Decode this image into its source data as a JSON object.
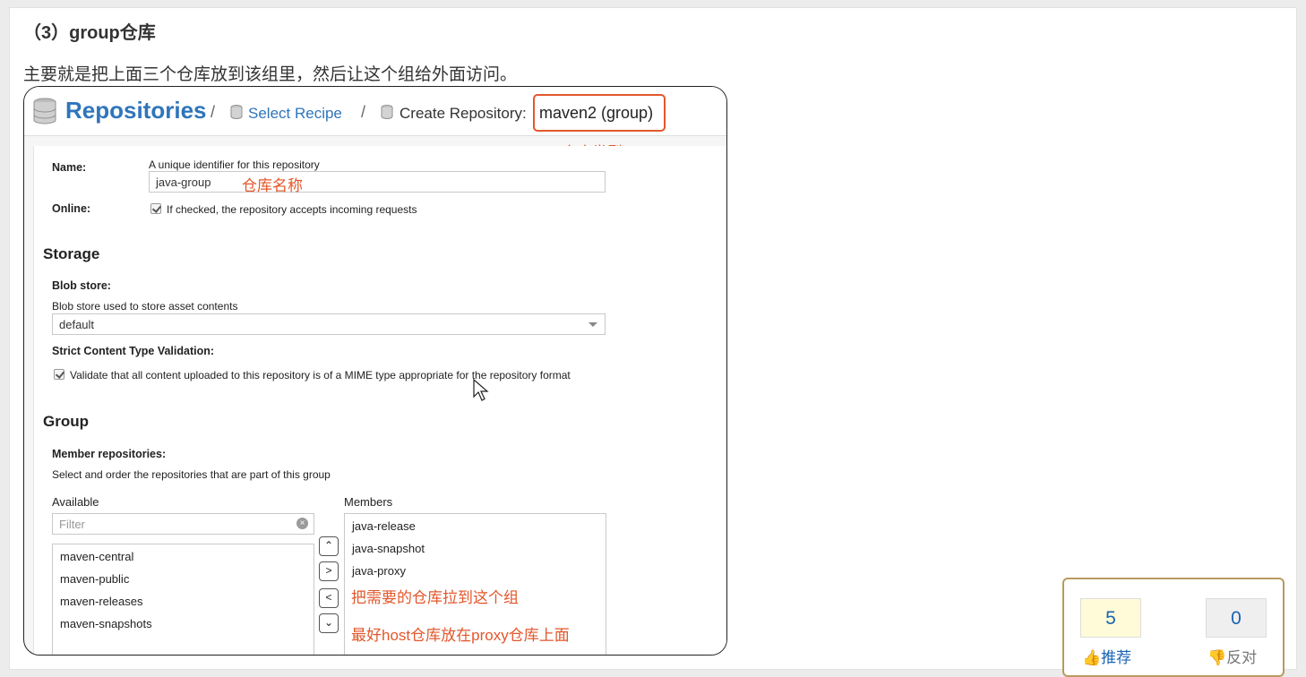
{
  "article": {
    "heading": "（3）group仓库",
    "intro": "主要就是把上面三个仓库放到该组里，然后让这个组给外面访问。"
  },
  "header": {
    "title": "Repositories",
    "separator": "/",
    "breadcrumb_recipe": "Select Recipe",
    "breadcrumb_create": "Create Repository:",
    "repo_type": "maven2 (group)"
  },
  "annotations": {
    "type": "仓库类型",
    "name": "仓库名称",
    "drag": "把需要的仓库拉到这个组",
    "order": "最好host仓库放在proxy仓库上面"
  },
  "form": {
    "name_label": "Name:",
    "name_help": "A unique identifier for this repository",
    "name_value": "java-group",
    "online_label": "Online:",
    "online_help": "If checked, the repository accepts incoming requests",
    "storage_title": "Storage",
    "blob_label": "Blob store:",
    "blob_help": "Blob store used to store asset contents",
    "blob_value": "default",
    "strict_label": "Strict Content Type Validation:",
    "strict_help": "Validate that all content uploaded to this repository is of a MIME type appropriate for the repository format",
    "group_title": "Group",
    "members_label": "Member repositories:",
    "members_help": "Select and order the repositories that are part of this group",
    "available_label": "Available",
    "members_col_label": "Members",
    "filter_placeholder": "Filter",
    "available": [
      "maven-central",
      "maven-public",
      "maven-releases",
      "maven-snapshots"
    ],
    "members": [
      "java-release",
      "java-snapshot",
      "java-proxy"
    ]
  },
  "vote": {
    "up_count": "5",
    "up_label": "推荐",
    "down_count": "0",
    "down_label": "反对"
  },
  "colors": {
    "accent": "#2f75bb",
    "annotation": "#e2572b"
  }
}
